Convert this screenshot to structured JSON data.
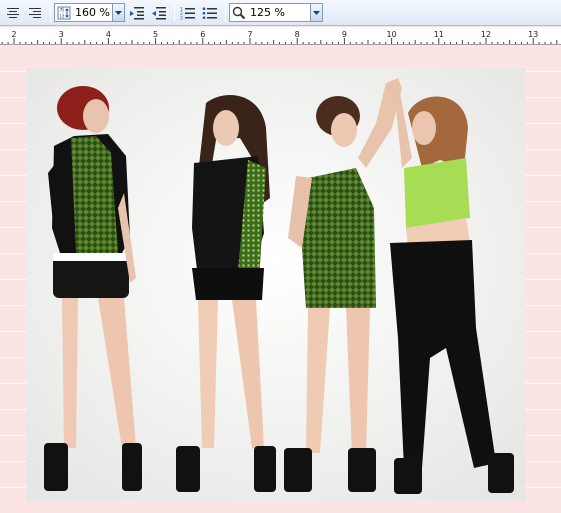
{
  "toolbar": {
    "align_center_icon": "align-center-icon",
    "align_right_icon": "align-right-icon",
    "line_spacing": {
      "icon": "line-spacing-icon",
      "value": "160 %"
    },
    "indent_icon": "indent-increase-icon",
    "outdent_icon": "indent-decrease-icon",
    "numbered_list_icon": "numbered-list-icon",
    "bullet_list_icon": "bullet-list-icon",
    "zoom": {
      "icon": "magnifier-icon",
      "value": "125 %"
    }
  },
  "ruler": {
    "labels": [
      "2",
      "3",
      "4",
      "5",
      "6",
      "7",
      "8",
      "9",
      "10",
      "11",
      "12",
      "13"
    ]
  },
  "document": {
    "image_description_icon": "photo-image"
  },
  "colors": {
    "page_background": "#fde4e4",
    "accent_green": "#8fd24a",
    "toolbar_top": "#f3f8fe",
    "toolbar_bottom": "#dfe9f6"
  }
}
